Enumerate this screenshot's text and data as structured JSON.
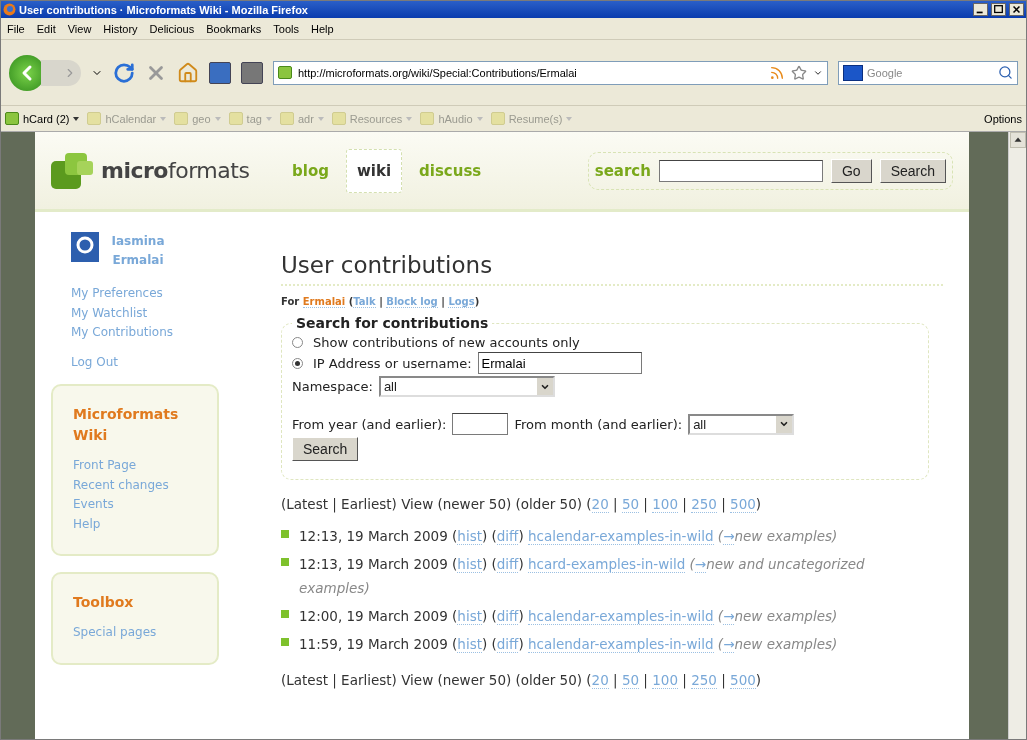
{
  "window": {
    "title": "User contributions · Microformats Wiki - Mozilla Firefox"
  },
  "menu": [
    "File",
    "Edit",
    "View",
    "History",
    "Delicious",
    "Bookmarks",
    "Tools",
    "Help"
  ],
  "toolbar": {
    "url": "http://microformats.org/wiki/Special:Contributions/Ermalai",
    "search_placeholder": "Google"
  },
  "bookmarks": [
    {
      "label": "hCard (2)",
      "active": true
    },
    {
      "label": "hCalendar",
      "active": false
    },
    {
      "label": "geo",
      "active": false
    },
    {
      "label": "tag",
      "active": false
    },
    {
      "label": "adr",
      "active": false
    },
    {
      "label": "Resources",
      "active": false
    },
    {
      "label": "hAudio",
      "active": false
    },
    {
      "label": "Resume(s)",
      "active": false
    }
  ],
  "bookmarks_options": "Options",
  "site": {
    "logo": "**micro**formats",
    "nav": [
      {
        "label": "blog",
        "selected": false
      },
      {
        "label": "wiki",
        "selected": true
      },
      {
        "label": "discuss",
        "selected": false
      }
    ],
    "search": {
      "label": "search",
      "buttons": [
        "Go",
        "Search"
      ]
    }
  },
  "sidebar": {
    "user": "Iasmina Ermalai",
    "user_links": [
      "My Preferences",
      "My Watchlist",
      "My Contributions"
    ],
    "logout": "Log Out",
    "portlets": [
      {
        "title": "Microformats Wiki",
        "links": [
          "Front Page",
          "Recent changes",
          "Events",
          "Help"
        ]
      },
      {
        "title": "Toolbox",
        "links": [
          "Special pages"
        ]
      }
    ]
  },
  "main": {
    "heading": "User contributions",
    "subtitle": [
      {
        "kind": "text",
        "text": "For "
      },
      {
        "kind": "user",
        "text": "Ermalai"
      },
      {
        "kind": "text",
        "text": " ("
      },
      {
        "kind": "link",
        "text": "Talk"
      },
      {
        "kind": "text",
        "text": " | "
      },
      {
        "kind": "link",
        "text": "Block log"
      },
      {
        "kind": "text",
        "text": " | "
      },
      {
        "kind": "link",
        "text": "Logs"
      },
      {
        "kind": "text",
        "text": ")"
      }
    ],
    "form": {
      "legend": "Search for contributions",
      "radios": [
        {
          "label": "Show contributions of new accounts only",
          "selected": false
        },
        {
          "label": "IP Address or username:",
          "selected": true
        }
      ],
      "username": "Ermalai",
      "namespace_label": "Namespace:",
      "namespace": "all",
      "year_label": "From year (and earlier):",
      "month_label": "From month (and earlier):",
      "month": "all",
      "button": "Search"
    },
    "pager": [
      {
        "kind": "text",
        "text": "(Latest | Earliest) View (newer 50) (older 50) ("
      },
      {
        "kind": "link",
        "text": "20"
      },
      {
        "kind": "text",
        "text": " | "
      },
      {
        "kind": "link",
        "text": "50"
      },
      {
        "kind": "text",
        "text": " | "
      },
      {
        "kind": "link",
        "text": "100"
      },
      {
        "kind": "text",
        "text": " | "
      },
      {
        "kind": "link",
        "text": "250"
      },
      {
        "kind": "text",
        "text": " | "
      },
      {
        "kind": "link",
        "text": "500"
      },
      {
        "kind": "text",
        "text": ")"
      }
    ],
    "contributions": [
      [
        {
          "kind": "text",
          "text": "12:13, 19 March 2009 ("
        },
        {
          "kind": "link",
          "text": "hist"
        },
        {
          "kind": "text",
          "text": ") ("
        },
        {
          "kind": "link",
          "text": "diff"
        },
        {
          "kind": "text",
          "text": ") "
        },
        {
          "kind": "link",
          "text": "hcalendar-examples-in-wild"
        },
        {
          "kind": "comment",
          "text": " ("
        },
        {
          "kind": "link",
          "text": "→"
        },
        {
          "kind": "comment",
          "text": "new examples)"
        }
      ],
      [
        {
          "kind": "text",
          "text": "12:13, 19 March 2009 ("
        },
        {
          "kind": "link",
          "text": "hist"
        },
        {
          "kind": "text",
          "text": ") ("
        },
        {
          "kind": "link",
          "text": "diff"
        },
        {
          "kind": "text",
          "text": ") "
        },
        {
          "kind": "link",
          "text": "hcard-examples-in-wild"
        },
        {
          "kind": "comment",
          "text": " ("
        },
        {
          "kind": "link",
          "text": "→"
        },
        {
          "kind": "comment",
          "text": "new and uncategorized examples)"
        }
      ],
      [
        {
          "kind": "text",
          "text": "12:00, 19 March 2009 ("
        },
        {
          "kind": "link",
          "text": "hist"
        },
        {
          "kind": "text",
          "text": ") ("
        },
        {
          "kind": "link",
          "text": "diff"
        },
        {
          "kind": "text",
          "text": ") "
        },
        {
          "kind": "link",
          "text": "hcalendar-examples-in-wild"
        },
        {
          "kind": "comment",
          "text": " ("
        },
        {
          "kind": "link",
          "text": "→"
        },
        {
          "kind": "comment",
          "text": "new examples)"
        }
      ],
      [
        {
          "kind": "text",
          "text": "11:59, 19 March 2009 ("
        },
        {
          "kind": "link",
          "text": "hist"
        },
        {
          "kind": "text",
          "text": ") ("
        },
        {
          "kind": "link",
          "text": "diff"
        },
        {
          "kind": "text",
          "text": ") "
        },
        {
          "kind": "link",
          "text": "hcalendar-examples-in-wild"
        },
        {
          "kind": "comment",
          "text": " ("
        },
        {
          "kind": "link",
          "text": "→"
        },
        {
          "kind": "comment",
          "text": "new examples)"
        }
      ]
    ],
    "pager_bottom": [
      {
        "kind": "text",
        "text": "(Latest | Earliest) View (newer 50) (older 50) ("
      },
      {
        "kind": "link",
        "text": "20"
      },
      {
        "kind": "text",
        "text": " | "
      },
      {
        "kind": "link",
        "text": "50"
      },
      {
        "kind": "text",
        "text": " | "
      },
      {
        "kind": "link",
        "text": "100"
      },
      {
        "kind": "text",
        "text": " | "
      },
      {
        "kind": "link",
        "text": "250"
      },
      {
        "kind": "text",
        "text": " | "
      },
      {
        "kind": "link",
        "text": "500"
      },
      {
        "kind": "text",
        "text": ")"
      }
    ]
  }
}
